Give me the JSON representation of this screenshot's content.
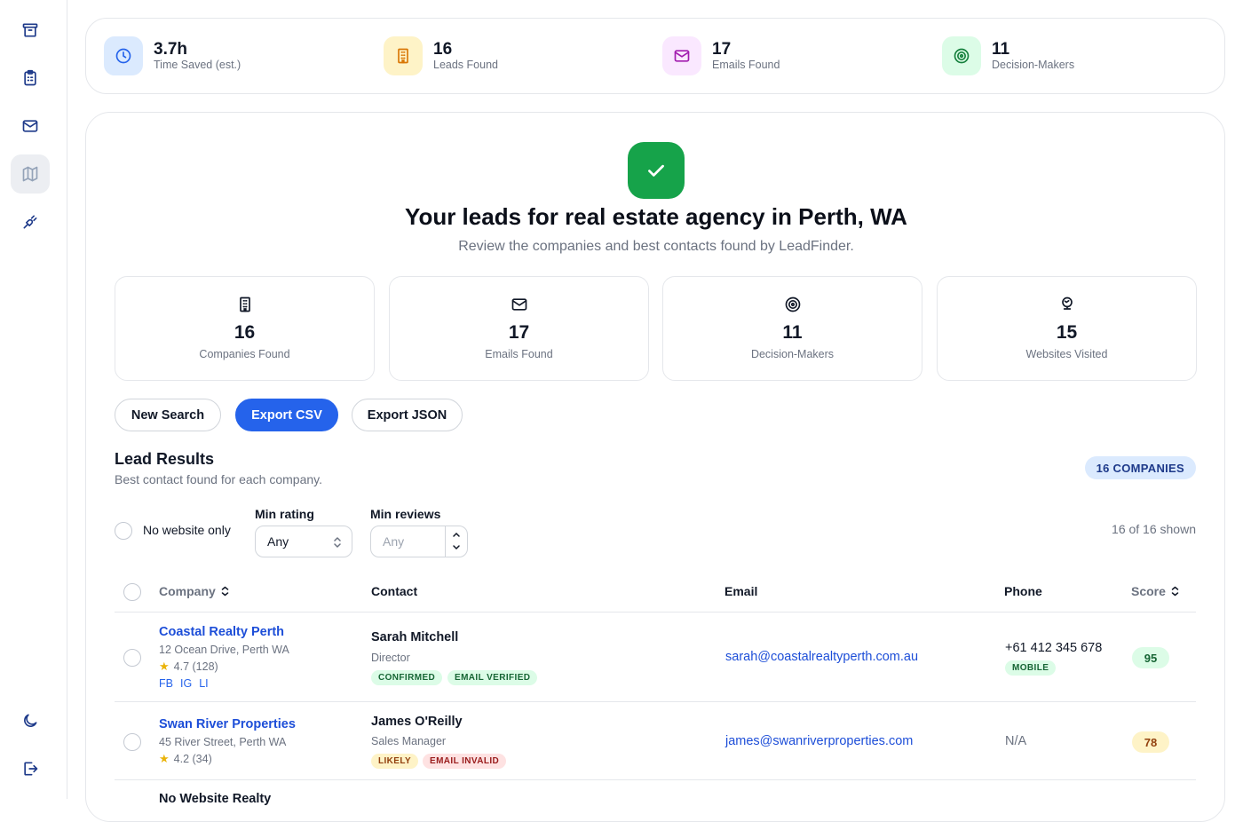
{
  "sidebar": {
    "items": [
      {
        "icon": "archive-icon"
      },
      {
        "icon": "clipboard-icon"
      },
      {
        "icon": "mail-icon"
      },
      {
        "icon": "map-icon",
        "active": true
      },
      {
        "icon": "plug-icon"
      }
    ],
    "bottom": [
      {
        "icon": "moon-icon"
      },
      {
        "icon": "logout-icon"
      }
    ]
  },
  "summary": [
    {
      "value": "3.7h",
      "label": "Time Saved (est.)",
      "icon": "clock-icon"
    },
    {
      "value": "16",
      "label": "Leads Found",
      "icon": "building-icon"
    },
    {
      "value": "17",
      "label": "Emails Found",
      "icon": "mail-icon"
    },
    {
      "value": "11",
      "label": "Decision-Makers",
      "icon": "target-icon"
    }
  ],
  "hero": {
    "title": "Your leads for real estate agency in Perth, WA",
    "subtitle": "Review the companies and best contacts found by LeadFinder."
  },
  "cards": [
    {
      "value": "16",
      "label": "Companies Found",
      "icon": "building-icon"
    },
    {
      "value": "17",
      "label": "Emails Found",
      "icon": "mail-icon"
    },
    {
      "value": "11",
      "label": "Decision-Makers",
      "icon": "target-icon"
    },
    {
      "value": "15",
      "label": "Websites Visited",
      "icon": "globe-icon"
    }
  ],
  "actions": {
    "new_search": "New Search",
    "export_csv": "Export CSV",
    "export_json": "Export JSON"
  },
  "results": {
    "title": "Lead Results",
    "subtitle": "Best contact found for each company.",
    "count_badge": "16 COMPANIES",
    "shown": "16 of 16 shown"
  },
  "filters": {
    "no_website_label": "No website only",
    "min_rating_label": "Min rating",
    "min_rating_value": "Any",
    "min_reviews_label": "Min reviews",
    "min_reviews_placeholder": "Any"
  },
  "table": {
    "headers": {
      "company": "Company",
      "contact": "Contact",
      "email": "Email",
      "phone": "Phone",
      "score": "Score"
    },
    "rows": [
      {
        "company": "Coastal Realty Perth",
        "address": "12 Ocean Drive, Perth WA",
        "rating": "4.7 (128)",
        "socials": [
          "FB",
          "IG",
          "LI"
        ],
        "contact": "Sarah Mitchell",
        "role": "Director",
        "tags": [
          "CONFIRMED",
          "EMAIL VERIFIED"
        ],
        "email": "sarah@coastalrealtyperth.com.au",
        "phone": "+61 412 345 678",
        "phone_type": "MOBILE",
        "score": "95",
        "score_color": "#dcfce7",
        "score_text_color": "#166534"
      },
      {
        "company": "Swan River Properties",
        "address": "45 River Street, Perth WA",
        "rating": "4.2 (34)",
        "contact": "James O'Reilly",
        "role": "Sales Manager",
        "tags": [
          "LIKELY",
          "EMAIL INVALID"
        ],
        "email": "james@swanriverproperties.com",
        "phone": "N/A",
        "score": "78",
        "score_color": "#fef3c7",
        "score_text_color": "#92400e"
      },
      {
        "company": "No Website Realty"
      }
    ]
  },
  "colors": {
    "primary": "#2563eb",
    "success": "#16a34a",
    "link": "#1d4ed8"
  }
}
